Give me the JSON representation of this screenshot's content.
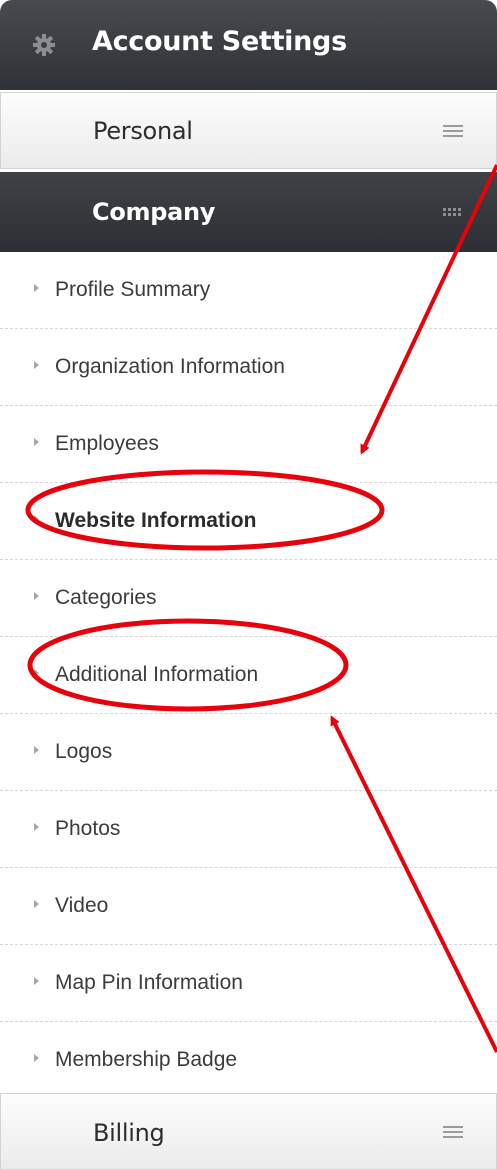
{
  "header": {
    "title": "Account Settings",
    "icon": "gear-icon"
  },
  "sections": {
    "personal": {
      "label": "Personal",
      "icon": "hamburger-icon"
    },
    "company": {
      "label": "Company",
      "icon": "grid-icon",
      "expanded": true
    },
    "billing": {
      "label": "Billing",
      "icon": "hamburger-icon"
    }
  },
  "company_menu": {
    "items": [
      {
        "label": "Profile Summary"
      },
      {
        "label": "Organization Information"
      },
      {
        "label": "Employees"
      },
      {
        "label": "Website Information",
        "active": true
      },
      {
        "label": "Categories"
      },
      {
        "label": "Additional Information"
      },
      {
        "label": "Logos"
      },
      {
        "label": "Photos"
      },
      {
        "label": "Video"
      },
      {
        "label": "Map Pin Information"
      },
      {
        "label": "Membership Badge"
      }
    ]
  },
  "annotations": {
    "color": "#e8000b",
    "circled_items": [
      "Website Information",
      "Additional Information"
    ]
  },
  "colors": {
    "header_bg": "#35383d",
    "section_light_bg": "#f2f2f2",
    "menu_text": "#3c3c3c",
    "bullet": "#a7a7a7"
  }
}
